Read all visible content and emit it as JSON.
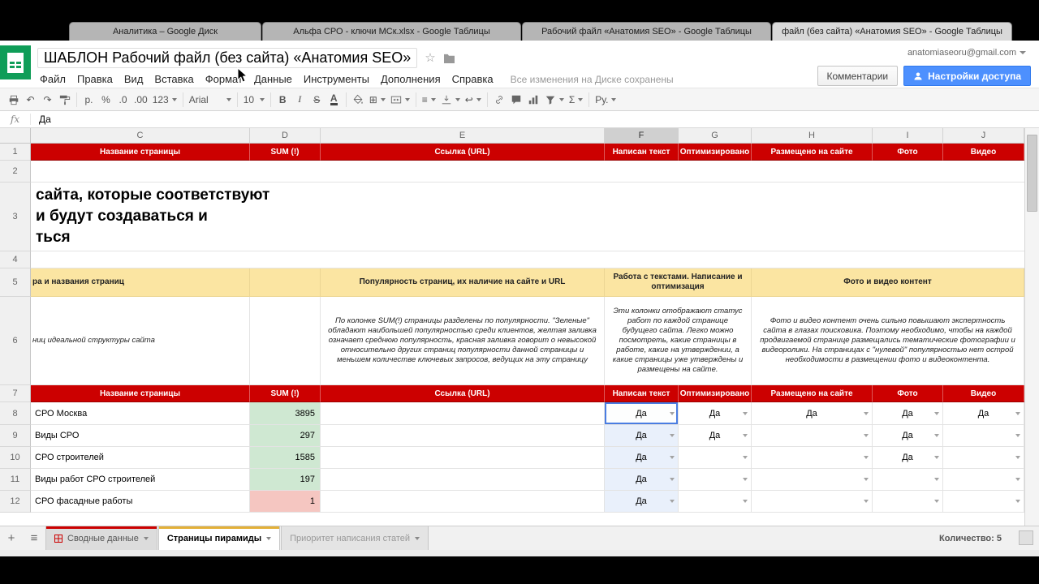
{
  "browser": {
    "tabs": [
      {
        "title": "Аналитика – Google Диск"
      },
      {
        "title": "Альфа СРО - ключи МСк.xlsx - Google Таблицы"
      },
      {
        "title": "Рабочий файл «Анатомия SEO» - Google Таблицы"
      },
      {
        "title": "файл (без сайта) «Анатомия SEO» - Google Таблицы"
      }
    ]
  },
  "header": {
    "title": "ШАБЛОН Рабочий файл (без сайта) «Анатомия SEO»",
    "account_email": "anatomiaseoru@gmail.com",
    "menu_items": [
      "Файл",
      "Правка",
      "Вид",
      "Вставка",
      "Формат",
      "Данные",
      "Инструменты",
      "Дополнения",
      "Справка"
    ],
    "save_status": "Все изменения на Диске сохранены",
    "comments_button": "Комментарии",
    "share_button": "Настройки доступа"
  },
  "toolbar": {
    "currency": "р.",
    "percent": "%",
    "dec_decrease": ".0",
    "dec_increase": ".00",
    "more_formats": "123",
    "font": "Arial",
    "font_size": "10",
    "bold": "B",
    "italic": "I",
    "strike": "S",
    "text_color": "A",
    "sigma": "Σ",
    "input_tools": "Ру."
  },
  "icons": {
    "undo": "↶",
    "redo": "↷",
    "borders": "⊞",
    "align": "≡",
    "wrap": "↩",
    "star": "☆",
    "add_sheet": "+",
    "all_sheets": "≡"
  },
  "formula_bar": {
    "fx": "fx",
    "value": "Да"
  },
  "grid": {
    "column_letters": [
      "C",
      "D",
      "E",
      "F",
      "G",
      "H",
      "I",
      "J"
    ],
    "selected_column": "F",
    "row_numbers": [
      "1",
      "2",
      "3",
      "4",
      "5",
      "6",
      "7",
      "8",
      "9",
      "10",
      "11",
      "12"
    ],
    "header_cells": [
      "Название страницы",
      "SUM (!)",
      "Ссылка (URL)",
      "Написан текст",
      "Оптимизировано",
      "Размещено на сайте",
      "Фото",
      "Видео"
    ],
    "big_text_lines": [
      "сайта, которые соответствуют",
      "и будут создаваться и",
      "ться"
    ],
    "section_row": {
      "c": "ра и названия страниц",
      "e": "Популярность страниц, их наличие на сайте и URL",
      "fg": "Работа с текстами. Написание и оптимизация",
      "hij": "Фото и видео контент"
    },
    "desc_row": {
      "c": "ниц идеальной структуры сайта",
      "e": "По колонке SUM(!) страницы разделены по популярности. \"Зеленые\" обладают наибольшей популярностью среди клиентов, желтая заливка означает среднюю популярность, красная заливка говорит о невысокой относительно других страниц популярности данной страницы и меньшем количестве ключевых запросов, ведущих на эту страницу",
      "fg": "Эти колонки отображают статус работ по каждой странице будущего сайта. Легко можно посмотреть, какие страницы в работе, какие на утверждении, а какие страницы уже утверждены и размещены на сайте.",
      "hij": "Фото и видео контент очень сильно повышают экспертность сайта в глазах поисковика. Поэтому необходимо, чтобы на каждой продвигаемой странице размещались тематические фотографии и видеоролики. На страницах с \"нулевой\" популярностью нет острой необходимости в размещении фото и видеоконтента."
    },
    "data_rows": [
      {
        "name": "СРО Москва",
        "sum": "3895",
        "sum_color": "#cfe8d2",
        "url": "",
        "text": "Да",
        "opt": "Да",
        "placed": "Да",
        "photo": "Да",
        "video": "Да"
      },
      {
        "name": "Виды СРО",
        "sum": "297",
        "sum_color": "#cfe8d2",
        "url": "",
        "text": "Да",
        "opt": "Да",
        "placed": "",
        "photo": "Да",
        "video": ""
      },
      {
        "name": "СРО строителей",
        "sum": "1585",
        "sum_color": "#cfe8d2",
        "url": "",
        "text": "Да",
        "opt": "",
        "placed": "",
        "photo": "Да",
        "video": ""
      },
      {
        "name": "Виды работ СРО строителей",
        "sum": "197",
        "sum_color": "#cfe8d2",
        "url": "",
        "text": "Да",
        "opt": "",
        "placed": "",
        "photo": "",
        "video": ""
      },
      {
        "name": "СРО фасадные работы",
        "sum": "1",
        "sum_color": "#f5c6c1",
        "url": "",
        "text": "Да",
        "opt": "",
        "placed": "",
        "photo": "",
        "video": ""
      }
    ]
  },
  "footer": {
    "tabs": [
      {
        "label": "Сводные данные",
        "color": "#cc0000",
        "active": false
      },
      {
        "label": "Страницы пирамиды",
        "color": "#e3b038",
        "active": true
      },
      {
        "label": "Приоритет написания статей",
        "color": "",
        "active": false
      }
    ],
    "count_label": "Количество: 5"
  },
  "colors": {
    "header_red": "#cc0000",
    "section_yellow": "#fbe5a2",
    "sum_green": "#cfe8d2",
    "sum_red": "#f5c6c1",
    "selection_blue": "#e9f0fb",
    "active_border": "#4a7de2",
    "share_button_blue": "#4d90fe"
  }
}
